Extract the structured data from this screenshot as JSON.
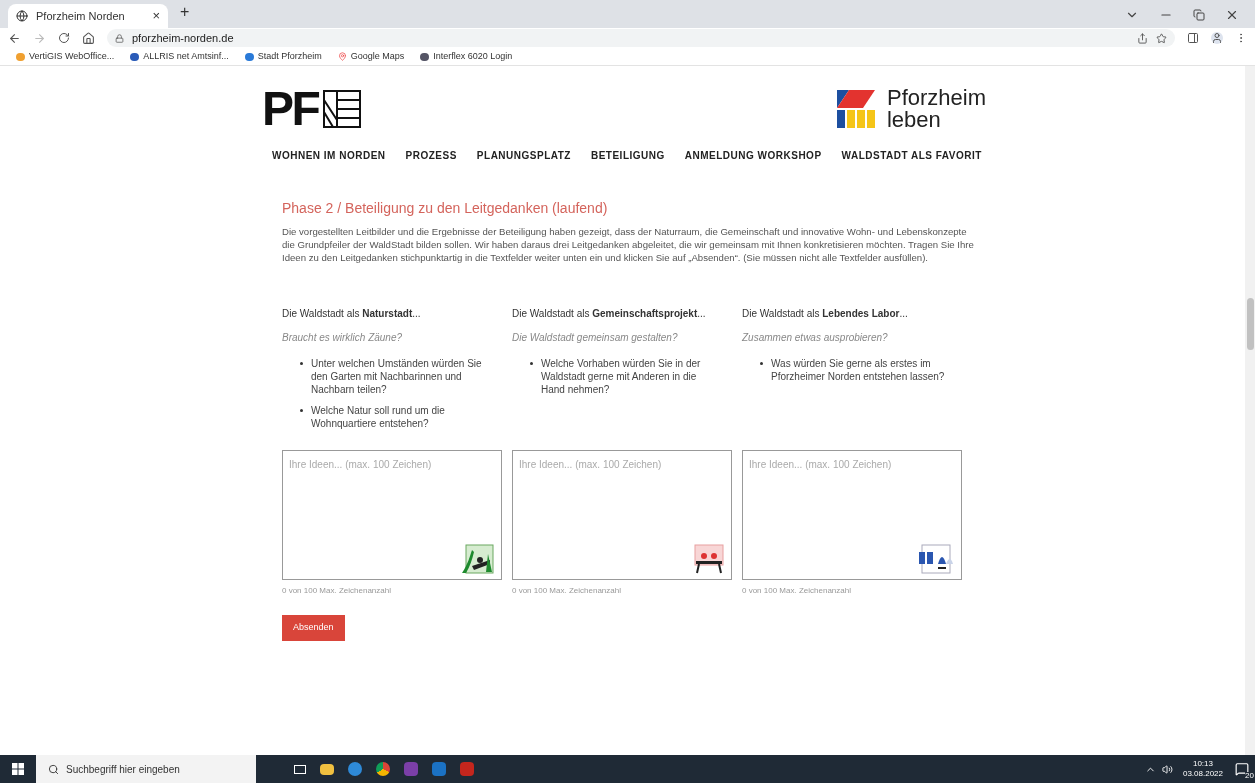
{
  "browser": {
    "tab": {
      "title": "Pforzheim Norden",
      "close": "×"
    },
    "new_tab": "+",
    "url": "pforzheim-norden.de",
    "bookmarks": [
      {
        "label": "VertiGIS WebOffice..."
      },
      {
        "label": "ALLRIS net Amtsinf..."
      },
      {
        "label": "Stadt Pforzheim"
      },
      {
        "label": "Google Maps"
      },
      {
        "label": "Interflex 6020 Login"
      }
    ]
  },
  "header": {
    "logo_text": "PF",
    "partner_logo": {
      "line1": "Pforzheim",
      "line2": "leben"
    },
    "nav": [
      {
        "label": "WOHNEN IM NORDEN"
      },
      {
        "label": "PROZESS"
      },
      {
        "label": "PLANUNGSPLATZ"
      },
      {
        "label": "BETEILIGUNG"
      },
      {
        "label": "ANMELDUNG WORKSHOP"
      },
      {
        "label": "WALDSTADT ALS FAVORIT"
      }
    ]
  },
  "section": {
    "title": "Phase 2 / Beteiligung zu den Leitgedanken (laufend)",
    "intro": "Die vorgestellten Leitbilder und die Ergebnisse der Beteiligung haben gezeigt, dass der Naturraum, die Gemeinschaft und innovative Wohn- und Lebenskonzepte die Grundpfeiler der WaldStadt bilden sollen. Wir haben daraus drei Leitgedanken abgeleitet, die wir gemeinsam mit Ihnen konkretisieren möchten. Tragen Sie Ihre Ideen zu den Leitgedanken stichpunktartig in die Textfelder weiter unten ein und klicken Sie auf „Absenden“. (Sie müssen nicht alle Textfelder ausfüllen).",
    "columns": [
      {
        "heading": "Die Waldstadt als **Naturstadt**...",
        "subtitle": "Braucht es wirklich Zäune?",
        "questions": [
          "Unter welchen Umständen würden Sie den Garten mit Nachbarinnen und Nachbarn teilen?",
          "Welche Natur soll rund um die Wohnquartiere entstehen?"
        ],
        "placeholder": "Ihre Ideen... (max. 100 Zeichen)",
        "counter": "0 von 100 Max. Zeichenanzahl",
        "kind": "nature"
      },
      {
        "heading": "Die Waldstadt als **Gemeinschaftsprojekt**...",
        "subtitle": "Die Waldstadt gemeinsam gestalten?",
        "questions": [
          "Welche Vorhaben würden Sie in der Waldstadt gerne mit Anderen in die Hand nehmen?"
        ],
        "placeholder": "Ihre Ideen... (max. 100 Zeichen)",
        "counter": "0 von 100 Max. Zeichenanzahl",
        "kind": "community"
      },
      {
        "heading": "Die Waldstadt als **Lebendes Labor**...",
        "subtitle": "Zusammen etwas ausprobieren?",
        "questions": [
          "Was würden Sie gerne als erstes im Pforzheimer Norden entstehen lassen?"
        ],
        "placeholder": "Ihre Ideen... (max. 100 Zeichen)",
        "counter": "0 von 100 Max. Zeichenanzahl",
        "kind": "lab"
      }
    ],
    "submit": "Absenden"
  },
  "taskbar": {
    "search_placeholder": "Suchbegriff hier eingeben",
    "time": "10:13",
    "date": "03.08.2022",
    "notifications": "20"
  }
}
